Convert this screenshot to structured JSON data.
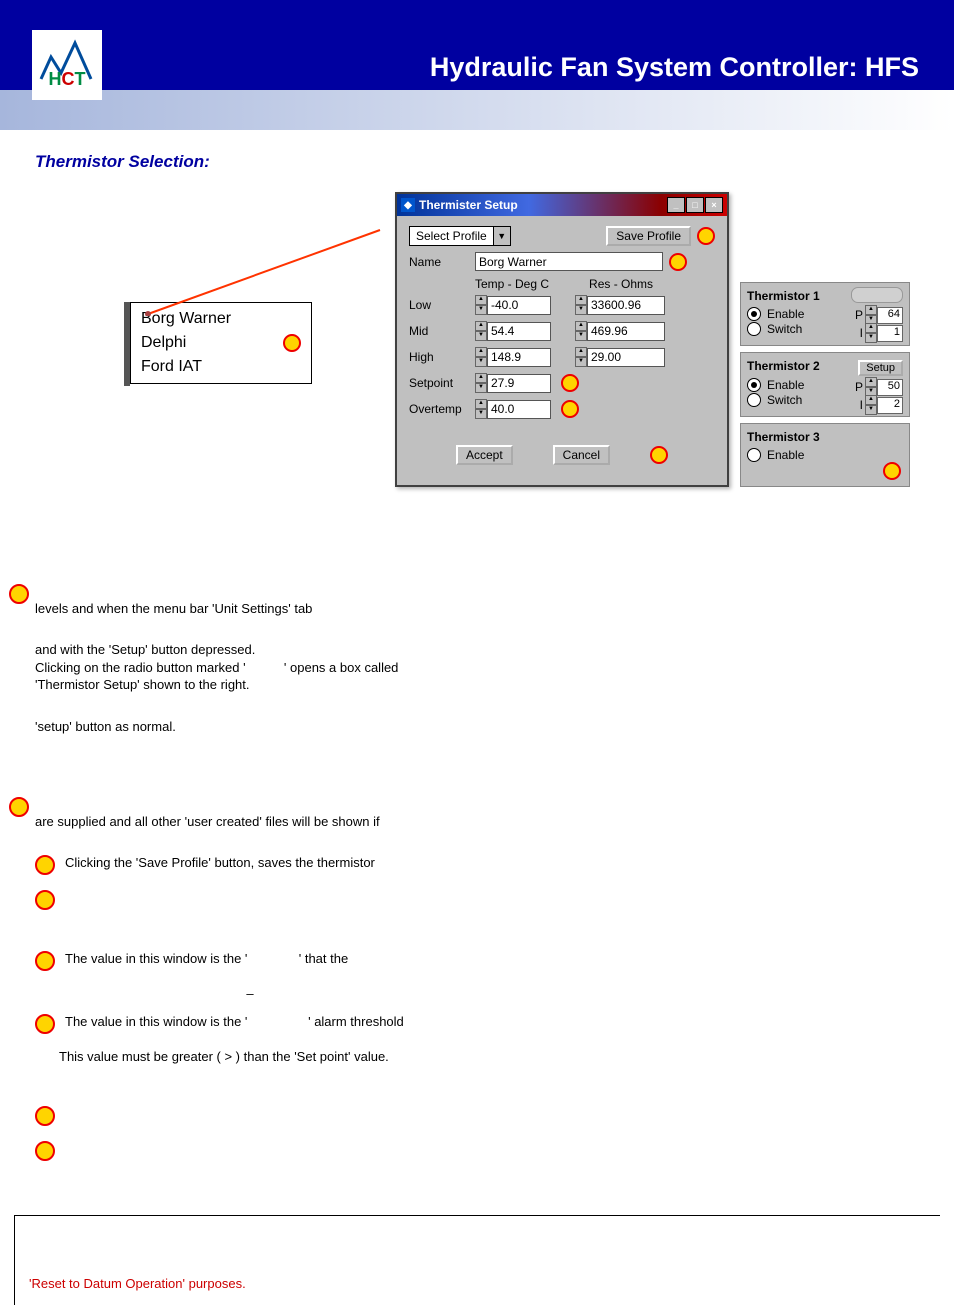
{
  "banner_title": "Hydraulic Fan System Controller: HFS",
  "section_title": "Thermistor Selection:",
  "dropdown": {
    "opt1": "Borg Warner",
    "opt2": "Delphi",
    "opt3": "Ford IAT"
  },
  "dialog": {
    "title": "Thermister Setup",
    "select_profile": "Select Profile",
    "save_profile": "Save Profile",
    "name_lbl": "Name",
    "name_val": "Borg Warner",
    "temp_hdr": "Temp - Deg C",
    "res_hdr": "Res - Ohms",
    "low": "Low",
    "low_t": "-40.0",
    "low_r": "33600.96",
    "mid": "Mid",
    "mid_t": "54.4",
    "mid_r": "469.96",
    "high": "High",
    "high_t": "148.9",
    "high_r": "29.00",
    "setpoint": "Setpoint",
    "setpoint_t": "27.9",
    "overtemp": "Overtemp",
    "overtemp_t": "40.0",
    "accept": "Accept",
    "cancel": "Cancel"
  },
  "panel": {
    "t1": "Thermistor 1",
    "t2": "Thermistor 2",
    "t3": "Thermistor 3",
    "enable": "Enable",
    "switch": "Switch",
    "setup": "Setup",
    "p": "P",
    "i": "I",
    "p1": "64",
    "i1": "1",
    "p2": "50",
    "i2": "2"
  },
  "text": {
    "l1": "levels and when the menu bar 'Unit Settings' tab",
    "l2a": "and with the 'Setup' button depressed.",
    "l2b": "Clicking on the radio button marked '",
    "l2c": "' opens a box called",
    "l2d": "'Thermistor Setup' shown to the right.",
    "l3": "'setup' button as normal.",
    "l4": "are supplied and all other 'user created' files will be shown if",
    "r1": "Clicking the 'Save Profile' button, saves the thermistor",
    "r2a": "The value in this window is the '",
    "r2b": "' that the",
    "r3": "–",
    "r4a": "The value in this window is the '",
    "r4b": "' alarm threshold",
    "r5": "This value must be greater ( > )  than the 'Set point' value.",
    "note": "'Reset to Datum Operation' purposes."
  }
}
